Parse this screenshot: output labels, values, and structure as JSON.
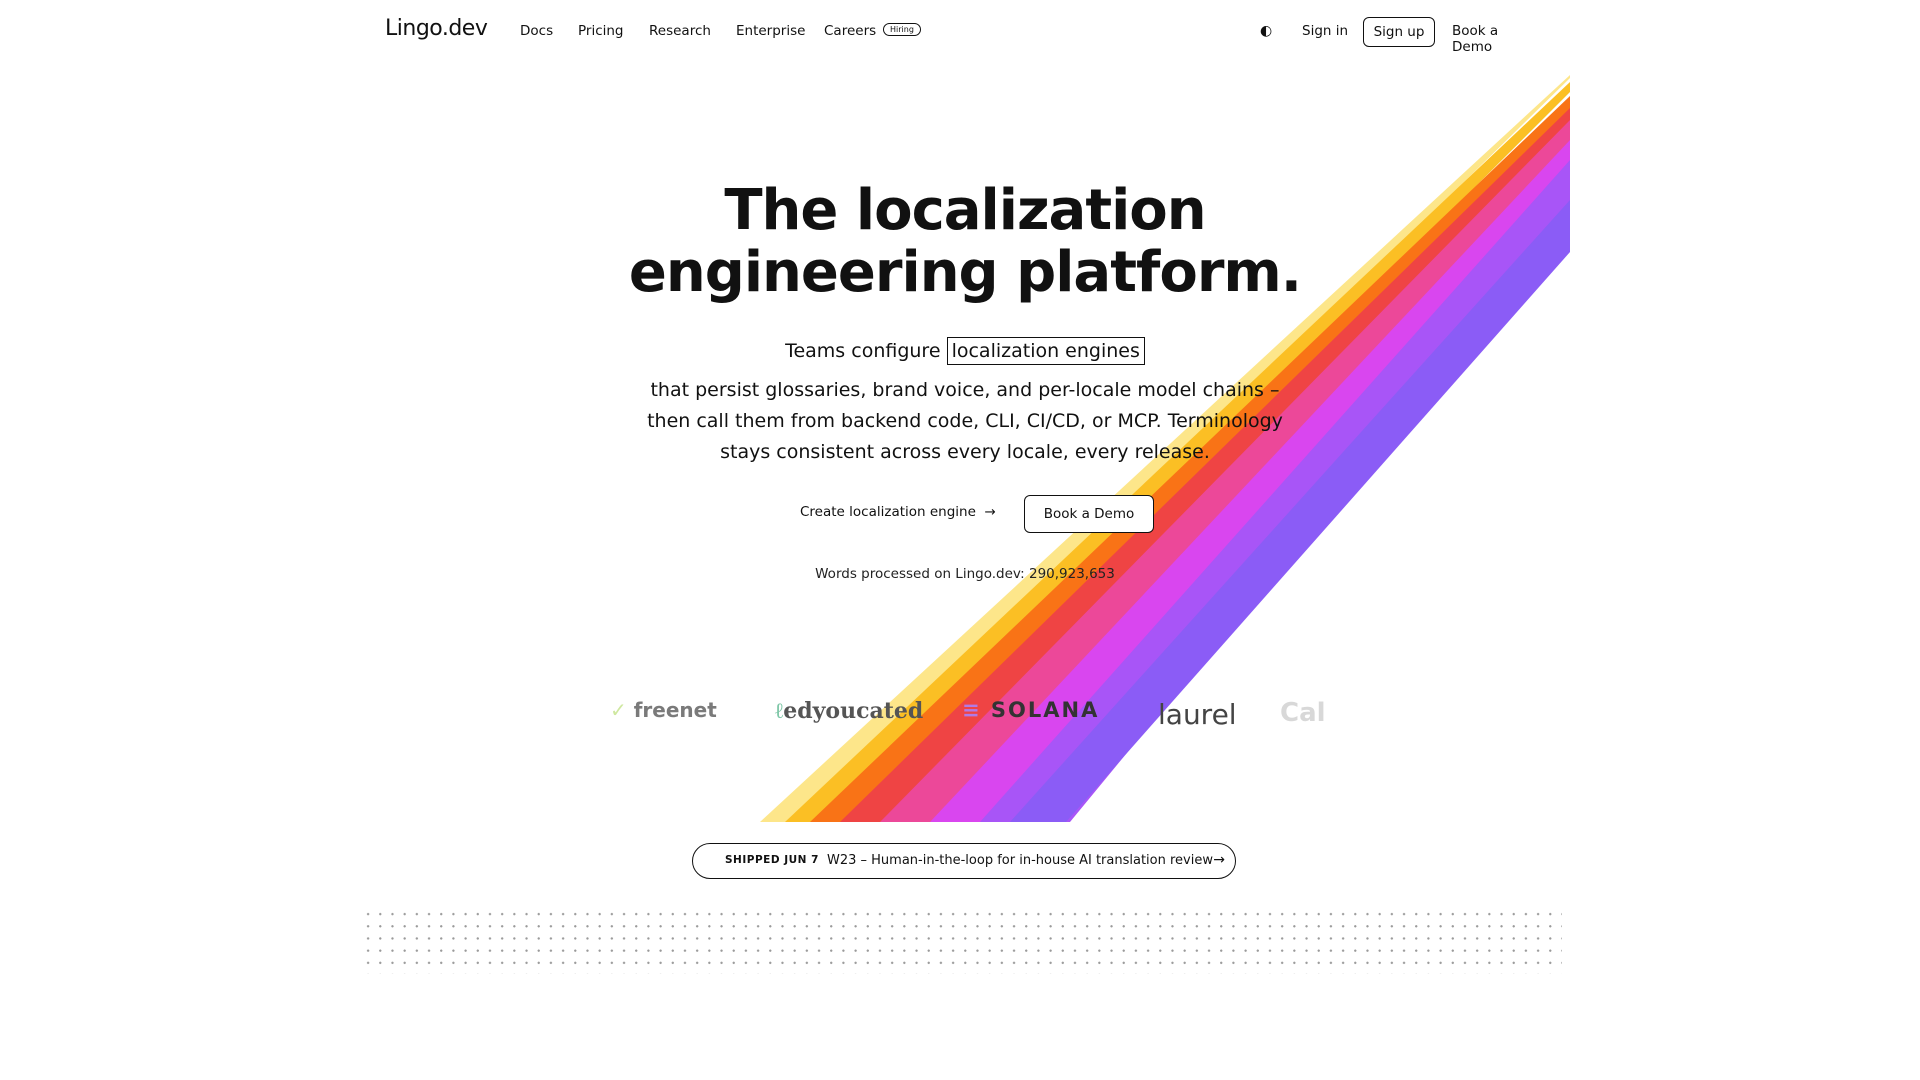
{
  "brand": {
    "logo": "Lingo.dev"
  },
  "nav": {
    "links": [
      "Docs",
      "Pricing",
      "Research",
      "Enterprise",
      "Careers"
    ],
    "hiring_badge": "Hiring",
    "sign_in": "Sign in",
    "sign_up": "Sign up",
    "book_demo": "Book a Demo"
  },
  "hero": {
    "title": "The localization engineering platform.",
    "subtitle_lead": "Teams configure",
    "subtitle_highlight": "localization engines",
    "subtitle_rest": "that persist glossaries, brand voice, and per-locale model chains – then call them from backend code, CLI, CI/CD, or MCP. Terminology stays consistent across every locale, every release.",
    "cta_primary": "Create localization engine",
    "cta_secondary": "Book a Demo",
    "words_label": "Words processed on Lingo.dev: 290,923,653"
  },
  "logos": [
    "freenet",
    "edyoucated",
    "SOLANA",
    "laurel",
    "Cal"
  ],
  "announcement": {
    "tag": "SHIPPED JUN 7",
    "text": "W23 – Human-in-the-loop for in-house AI translation review"
  },
  "colors": {
    "rainbow": [
      "#fde68a",
      "#fbbf24",
      "#f97316",
      "#ef4444",
      "#ec4899",
      "#d946ef",
      "#a855f7",
      "#8b5cf6"
    ]
  }
}
